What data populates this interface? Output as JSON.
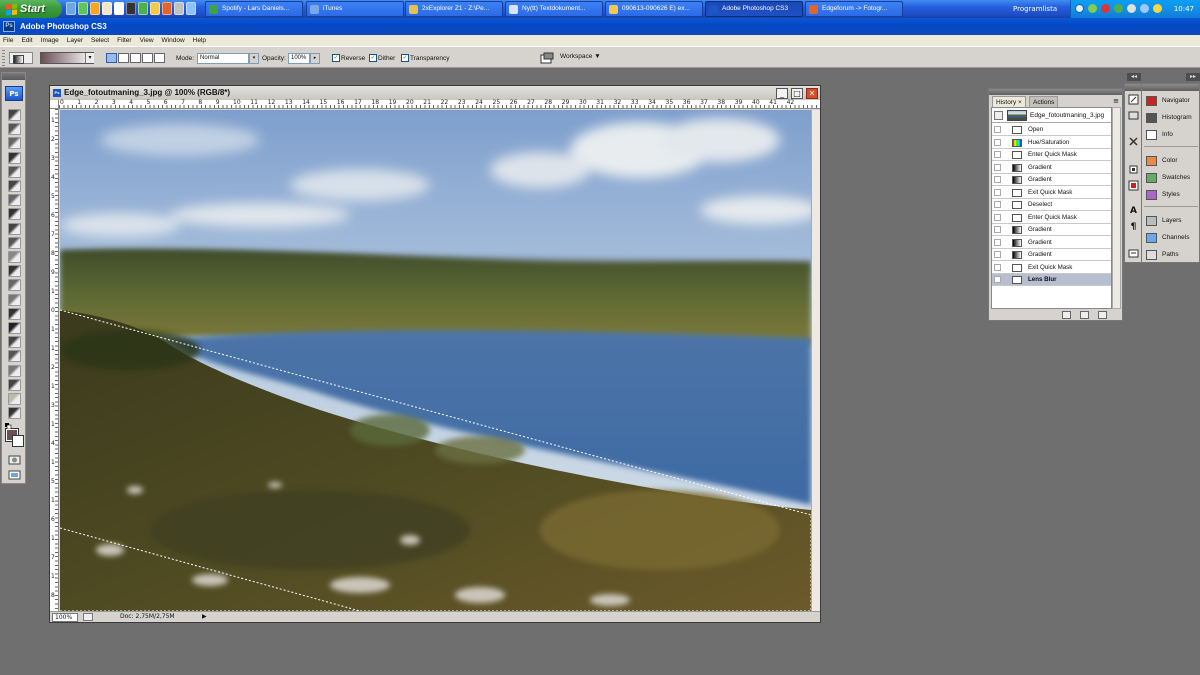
{
  "taskbar": {
    "start_label": "Start",
    "tasks": [
      {
        "label": "Spotify - Lars Daniels...",
        "icon": "spotify-icon",
        "color": "#3fa43b"
      },
      {
        "label": "iTunes",
        "icon": "itunes-icon",
        "color": "#7aa7e6"
      },
      {
        "label": "2xExplorer Z1 - Z:\\Pe...",
        "icon": "explorer-icon",
        "color": "#e7c24a"
      },
      {
        "label": "Ny(tt) Textdokument...",
        "icon": "notepad-icon",
        "color": "#d8e4f4"
      },
      {
        "label": "090613-090626 E) ex...",
        "icon": "folder-icon",
        "color": "#f2c94c"
      },
      {
        "label": "Adobe Photoshop CS3",
        "icon": "photoshop-icon",
        "color": "#1b56c7"
      },
      {
        "label": "Edgeforum -> Fotogr...",
        "icon": "firefox-icon",
        "color": "#e0652a"
      }
    ],
    "tray_label": "Programlista",
    "clock": "10:47"
  },
  "app": {
    "title": "Adobe Photoshop CS3",
    "icon_text": "Ps"
  },
  "menu": [
    "File",
    "Edit",
    "Image",
    "Layer",
    "Select",
    "Filter",
    "View",
    "Window",
    "Help"
  ],
  "options": {
    "mode_label": "Mode:",
    "mode_value": "Normal",
    "opacity_label": "Opacity:",
    "opacity_value": "100%",
    "reverse_label": "Reverse",
    "reverse_checked": true,
    "dither_label": "Dither",
    "dither_checked": true,
    "transparency_label": "Transparency",
    "transparency_checked": true,
    "workspace_label": "Workspace",
    "workspace_arrow": "▼",
    "gradient_colors": [
      "#6c4d55",
      "#ffffff"
    ],
    "dropdown_arrow": "▾",
    "step_arrow": "▸",
    "check_mark": "✓"
  },
  "toolbox": {
    "logo": "Ps",
    "foreground_color": "#6e4f58",
    "background_color": "#ffffff",
    "tools": [
      "move-tool-icon",
      "marquee-tool-icon",
      "lasso-tool-icon",
      "magic-wand-tool-icon",
      "crop-tool-icon",
      "slice-tool-icon",
      "healing-brush-tool-icon",
      "brush-tool-icon",
      "clone-stamp-tool-icon",
      "history-brush-tool-icon",
      "eraser-tool-icon",
      "gradient-tool-icon",
      "blur-tool-icon",
      "dodge-tool-icon",
      "pen-tool-icon",
      "type-tool-icon",
      "path-selection-tool-icon",
      "shape-tool-icon",
      "notes-tool-icon",
      "eyedropper-tool-icon",
      "hand-tool-icon",
      "zoom-tool-icon"
    ]
  },
  "document": {
    "title": "Edge_fotoutmaning_3.jpg @ 100% (RGB/8*)",
    "minimize": "_",
    "maximize": "□",
    "close": "✕",
    "zoom": "100%",
    "doc_info": "Doc: 2,75M/2,75M",
    "status_arrow": "▶",
    "ruler_top": [
      "0",
      "1",
      "2",
      "3",
      "4",
      "5",
      "6",
      "7",
      "8",
      "9",
      "10",
      "11",
      "12",
      "13",
      "14",
      "15",
      "16",
      "17",
      "18",
      "19",
      "20",
      "21",
      "22",
      "23",
      "24",
      "25",
      "26",
      "27",
      "28",
      "29",
      "30",
      "31",
      "32",
      "33",
      "34",
      "35",
      "36",
      "37",
      "38",
      "39",
      "40",
      "41",
      "42"
    ],
    "ruler_left": [
      "1",
      "2",
      "3",
      "4",
      "5",
      "6",
      "7",
      "8",
      "9",
      "1",
      "0",
      "1",
      "1",
      "2",
      "1",
      "3",
      "1",
      "4",
      "1",
      "5",
      "1",
      "6",
      "1",
      "7",
      "1",
      "8"
    ]
  },
  "history": {
    "tabs": [
      "History",
      "Actions"
    ],
    "tab_close": "×",
    "menu_glyph": "≡",
    "snapshot_name": "Edge_fotoutmaning_3.jpg",
    "states": [
      "Open",
      "Hue/Saturation",
      "Enter Quick Mask",
      "Gradient",
      "Gradient",
      "Exit Quick Mask",
      "Deselect",
      "Enter Quick Mask",
      "Gradient",
      "Gradient",
      "Gradient",
      "Exit Quick Mask",
      "Lens Blur"
    ],
    "selected_index": 12
  },
  "dock": {
    "panels": [
      "Navigator",
      "Histogram",
      "Info",
      "Color",
      "Swatches",
      "Styles",
      "Layers",
      "Channels",
      "Paths"
    ],
    "collapse_glyph": "◂◂",
    "expand_glyph": "▸▸"
  }
}
